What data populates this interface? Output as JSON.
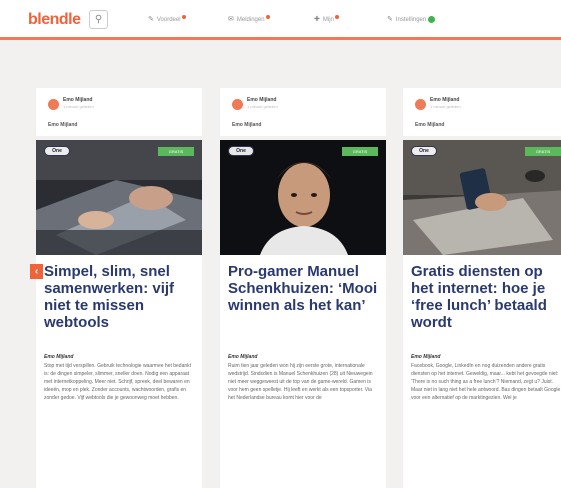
{
  "header": {
    "logo": "blendle",
    "search_glyph": "⚲",
    "nav": [
      {
        "label": "Voordeel",
        "icon": "pencil-icon",
        "badge": "dot"
      },
      {
        "label": "Meldingen",
        "icon": "mail-icon",
        "badge": "dot"
      },
      {
        "label": "Mijn",
        "icon": "pin-icon",
        "badge": "dot"
      },
      {
        "label": "Instellingen",
        "icon": "pencil-icon",
        "badge": "green"
      }
    ]
  },
  "columns": [
    {
      "author": "Emo Mijland",
      "time": "1 minuut geleden",
      "author_sub": "Emo Mijland",
      "brand": "One",
      "tag": "GRATIS",
      "headline": "Simpel, slim, snel samenwerken: vijf niet te missen webtools",
      "byline": "Emo Mijland",
      "excerpt": "Stop met tijd verspillen. Gebruik technologie waarmee het bedankt is: de dingen simpeler, slimmer, sneller doen. Nodig een apparaat met internetkoppeling. Meer niet. Schrijf, spreek, deel bewaren en ideeën, mop en plek. Zonder accounts, wachtwoorden, grafis en zonder gedoe. Vijf webtools die je gewoonweg moet hebben."
    },
    {
      "author": "Emo Mijland",
      "time": "1 minuut geleden",
      "author_sub": "Emo Mijland",
      "brand": "One",
      "tag": "GRATIS",
      "headline": "Pro-gamer Manuel Schenkhuizen: ‘Mooi winnen als het kan’",
      "byline": "Emo Mijland",
      "excerpt": "Ruim tien jaar geleden won hij zijn eerste grote, internationale wedstrijd. Sindsdien is Manuel Schenkhuizen (28) uit Nieuwegein niet meer weggeweest uit de top van de game-wereld. Gamen is voor hem geen spelletje. Hij leeft en werkt als een topsporter. Via het Nederlandse bureau komt hier voor de"
    },
    {
      "author": "Emo Mijland",
      "time": "1 minuut geleden",
      "author_sub": "Emo Mijland",
      "brand": "One",
      "tag": "GRATIS",
      "headline": "Gratis diensten op het internet: hoe je ‘free lunch’ betaald wordt",
      "byline": "Emo Mijland",
      "excerpt": "Facebook, Google, LinkedIn en nog duizenden andere gratis diensten op het internet. Geweldig, maar... kebt het gevoegde niet: ‘There is no such thing as a free lunch’? Niemand, zegt u? Juist. Maar niet in lang niet het hele antwoord. Bas dingen betaalt Google voor een alternatief op de marktingezien. Wel je"
    }
  ],
  "colors": {
    "accent": "#f0623a",
    "headline": "#2a3a6e",
    "tag": "#5cb85c"
  }
}
